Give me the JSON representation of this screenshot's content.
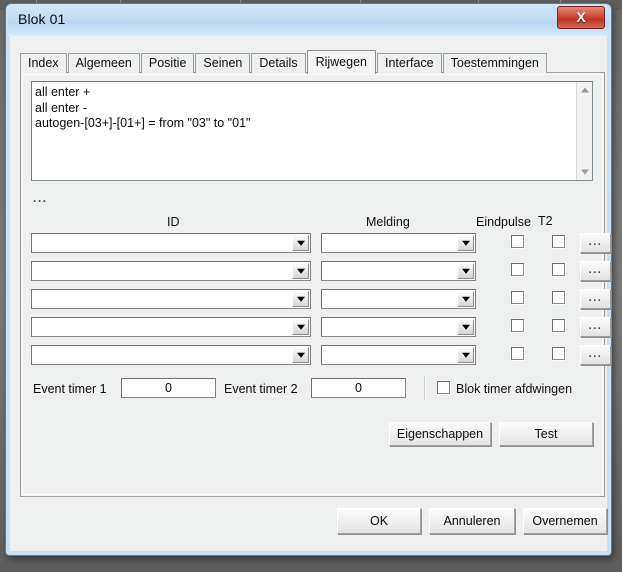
{
  "window": {
    "title": "Blok 01",
    "close_icon": "close-x-icon"
  },
  "tabs": [
    {
      "label": "Index",
      "selected": false
    },
    {
      "label": "Algemeen",
      "selected": false
    },
    {
      "label": "Positie",
      "selected": false
    },
    {
      "label": "Seinen",
      "selected": false
    },
    {
      "label": "Details",
      "selected": false
    },
    {
      "label": "Rijwegen",
      "selected": true
    },
    {
      "label": "Interface",
      "selected": false
    },
    {
      "label": "Toestemmingen",
      "selected": false
    }
  ],
  "script_box": {
    "lines": [
      "all enter +",
      "all enter -",
      "autogen-[03+]-[01+] = from \"03\" to \"01\""
    ],
    "text": "all enter +\nall enter -\nautogen-[03+]-[01+] = from \"03\" to \"01\"",
    "scroll_up_icon": "triangle-up-icon",
    "scroll_down_icon": "triangle-down-icon"
  },
  "dots_label": "...",
  "grid": {
    "headers": {
      "id": "ID",
      "melding": "Melding",
      "eindpulse": "Eindpulse",
      "t2": "T2"
    },
    "rows": [
      {
        "id_value": "",
        "melding_value": "",
        "eindpulse_checked": false,
        "t2_checked": false,
        "browse_label": "..."
      },
      {
        "id_value": "",
        "melding_value": "",
        "eindpulse_checked": false,
        "t2_checked": false,
        "browse_label": "..."
      },
      {
        "id_value": "",
        "melding_value": "",
        "eindpulse_checked": false,
        "t2_checked": false,
        "browse_label": "..."
      },
      {
        "id_value": "",
        "melding_value": "",
        "eindpulse_checked": false,
        "t2_checked": false,
        "browse_label": "..."
      },
      {
        "id_value": "",
        "melding_value": "",
        "eindpulse_checked": false,
        "t2_checked": false,
        "browse_label": "..."
      }
    ]
  },
  "timers": {
    "event_timer_1_label": "Event timer 1",
    "event_timer_1_value": "0",
    "event_timer_2_label": "Event timer 2",
    "event_timer_2_value": "0",
    "blok_timer_label": "Blok timer afdwingen",
    "blok_timer_checked": false
  },
  "actions": {
    "eigenschappen": "Eigenschappen",
    "test": "Test"
  },
  "footer": {
    "ok": "OK",
    "cancel": "Annuleren",
    "apply": "Overnemen"
  },
  "colors": {
    "title_bar": "#c3dcf2",
    "dialog_frame": "#c9e0f4",
    "face": "#eef0ef",
    "close_button": "#b93423",
    "desktop": "#6e6e6e"
  }
}
